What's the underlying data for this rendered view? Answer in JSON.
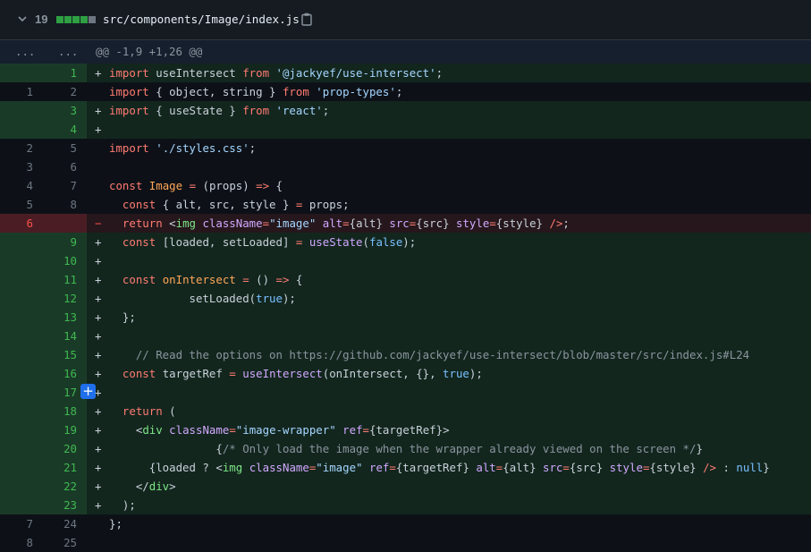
{
  "file": {
    "changes": "19",
    "path": "src/components/Image/index.js",
    "diffstat": [
      "add",
      "add",
      "add",
      "add",
      "neutral"
    ],
    "colors": {
      "add": "#2ea043",
      "neutral": "#6e7681"
    }
  },
  "hunk": {
    "old_expander": "...",
    "new_expander": "...",
    "header": "@@ -1,9 +1,26 @@"
  },
  "lines": [
    {
      "type": "add",
      "old": "",
      "new": "1",
      "sign": "+",
      "tokens": [
        [
          "kw",
          "import"
        ],
        [
          "pl",
          " useIntersect "
        ],
        [
          "kw",
          "from"
        ],
        [
          "pl",
          " "
        ],
        [
          "str",
          "'@jackyef/use-intersect'"
        ],
        [
          "pl",
          ";"
        ]
      ]
    },
    {
      "type": "ctx",
      "old": "1",
      "new": "2",
      "sign": "",
      "tokens": [
        [
          "kw",
          "import"
        ],
        [
          "pl",
          " { object, string } "
        ],
        [
          "kw",
          "from"
        ],
        [
          "pl",
          " "
        ],
        [
          "str",
          "'prop-types'"
        ],
        [
          "pl",
          ";"
        ]
      ]
    },
    {
      "type": "add",
      "old": "",
      "new": "3",
      "sign": "+",
      "tokens": [
        [
          "kw",
          "import"
        ],
        [
          "pl",
          " { useState } "
        ],
        [
          "kw",
          "from"
        ],
        [
          "pl",
          " "
        ],
        [
          "str",
          "'react'"
        ],
        [
          "pl",
          ";"
        ]
      ]
    },
    {
      "type": "add",
      "old": "",
      "new": "4",
      "sign": "+",
      "tokens": []
    },
    {
      "type": "ctx",
      "old": "2",
      "new": "5",
      "sign": "",
      "tokens": [
        [
          "kw",
          "import"
        ],
        [
          "pl",
          " "
        ],
        [
          "str",
          "'./styles.css'"
        ],
        [
          "pl",
          ";"
        ]
      ]
    },
    {
      "type": "ctx",
      "old": "3",
      "new": "6",
      "sign": "",
      "tokens": []
    },
    {
      "type": "ctx",
      "old": "4",
      "new": "7",
      "sign": "",
      "tokens": [
        [
          "kw",
          "const"
        ],
        [
          "pl",
          " "
        ],
        [
          "nm",
          "Image"
        ],
        [
          "pl",
          " "
        ],
        [
          "kw",
          "="
        ],
        [
          "pl",
          " (props) "
        ],
        [
          "kw",
          "=>"
        ],
        [
          "pl",
          " {"
        ]
      ]
    },
    {
      "type": "ctx",
      "old": "5",
      "new": "8",
      "sign": "",
      "tokens": [
        [
          "pl",
          "  "
        ],
        [
          "kw",
          "const"
        ],
        [
          "pl",
          " { alt, src, style } "
        ],
        [
          "kw",
          "="
        ],
        [
          "pl",
          " props;"
        ]
      ]
    },
    {
      "type": "del",
      "old": "6",
      "new": "",
      "sign": "−",
      "tokens": [
        [
          "pl",
          "  "
        ],
        [
          "kw",
          "return"
        ],
        [
          "pl",
          " <"
        ],
        [
          "tag",
          "img"
        ],
        [
          "pl",
          " "
        ],
        [
          "attr",
          "className"
        ],
        [
          "kw",
          "="
        ],
        [
          "str",
          "\"image\""
        ],
        [
          "pl",
          " "
        ],
        [
          "attr",
          "alt"
        ],
        [
          "kw",
          "="
        ],
        [
          "pl",
          "{alt} "
        ],
        [
          "attr",
          "src"
        ],
        [
          "kw",
          "="
        ],
        [
          "pl",
          "{src} "
        ],
        [
          "attr",
          "style"
        ],
        [
          "kw",
          "="
        ],
        [
          "pl",
          "{style} "
        ],
        [
          "kw",
          "/>"
        ],
        [
          "pl",
          ";"
        ]
      ]
    },
    {
      "type": "add",
      "old": "",
      "new": "9",
      "sign": "+",
      "tokens": [
        [
          "pl",
          "  "
        ],
        [
          "kw",
          "const"
        ],
        [
          "pl",
          " [loaded, setLoaded] "
        ],
        [
          "kw",
          "="
        ],
        [
          "pl",
          " "
        ],
        [
          "fn",
          "useState"
        ],
        [
          "pl",
          "("
        ],
        [
          "bool",
          "false"
        ],
        [
          "pl",
          ");"
        ]
      ]
    },
    {
      "type": "add",
      "old": "",
      "new": "10",
      "sign": "+",
      "tokens": []
    },
    {
      "type": "add",
      "old": "",
      "new": "11",
      "sign": "+",
      "tokens": [
        [
          "pl",
          "  "
        ],
        [
          "kw",
          "const"
        ],
        [
          "pl",
          " "
        ],
        [
          "nm",
          "onIntersect"
        ],
        [
          "pl",
          " "
        ],
        [
          "kw",
          "="
        ],
        [
          "pl",
          " () "
        ],
        [
          "kw",
          "=>"
        ],
        [
          "pl",
          " {"
        ]
      ]
    },
    {
      "type": "add",
      "old": "",
      "new": "12",
      "sign": "+",
      "tokens": [
        [
          "pl",
          "            setLoaded("
        ],
        [
          "bool",
          "true"
        ],
        [
          "pl",
          ");"
        ]
      ]
    },
    {
      "type": "add",
      "old": "",
      "new": "13",
      "sign": "+",
      "tokens": [
        [
          "pl",
          "  };"
        ]
      ]
    },
    {
      "type": "add",
      "old": "",
      "new": "14",
      "sign": "+",
      "tokens": []
    },
    {
      "type": "add",
      "old": "",
      "new": "15",
      "sign": "+",
      "tokens": [
        [
          "pl",
          "    "
        ],
        [
          "cm",
          "// Read the options on https://github.com/jackyef/use-intersect/blob/master/src/index.js#L24"
        ]
      ]
    },
    {
      "type": "add",
      "old": "",
      "new": "16",
      "sign": "+",
      "tokens": [
        [
          "pl",
          "  "
        ],
        [
          "kw",
          "const"
        ],
        [
          "pl",
          " targetRef "
        ],
        [
          "kw",
          "="
        ],
        [
          "pl",
          " "
        ],
        [
          "fn",
          "useIntersect"
        ],
        [
          "pl",
          "(onIntersect, {}, "
        ],
        [
          "bool",
          "true"
        ],
        [
          "pl",
          ");"
        ]
      ]
    },
    {
      "type": "add",
      "old": "",
      "new": "17",
      "sign": "+",
      "tokens": [],
      "hover": true
    },
    {
      "type": "add",
      "old": "",
      "new": "18",
      "sign": "+",
      "tokens": [
        [
          "pl",
          "  "
        ],
        [
          "kw",
          "return"
        ],
        [
          "pl",
          " ("
        ]
      ]
    },
    {
      "type": "add",
      "old": "",
      "new": "19",
      "sign": "+",
      "tokens": [
        [
          "pl",
          "    <"
        ],
        [
          "tag",
          "div"
        ],
        [
          "pl",
          " "
        ],
        [
          "attr",
          "className"
        ],
        [
          "kw",
          "="
        ],
        [
          "str",
          "\"image-wrapper\""
        ],
        [
          "pl",
          " "
        ],
        [
          "attr",
          "ref"
        ],
        [
          "kw",
          "="
        ],
        [
          "pl",
          "{targetRef}>"
        ]
      ]
    },
    {
      "type": "add",
      "old": "",
      "new": "20",
      "sign": "+",
      "tokens": [
        [
          "pl",
          "                {"
        ],
        [
          "cm",
          "/* Only load the image when the wrapper already viewed on the screen */"
        ],
        [
          "pl",
          "}"
        ]
      ]
    },
    {
      "type": "add",
      "old": "",
      "new": "21",
      "sign": "+",
      "tokens": [
        [
          "pl",
          "      {loaded ? <"
        ],
        [
          "tag",
          "img"
        ],
        [
          "pl",
          " "
        ],
        [
          "attr",
          "className"
        ],
        [
          "kw",
          "="
        ],
        [
          "str",
          "\"image\""
        ],
        [
          "pl",
          " "
        ],
        [
          "attr",
          "ref"
        ],
        [
          "kw",
          "="
        ],
        [
          "pl",
          "{targetRef} "
        ],
        [
          "attr",
          "alt"
        ],
        [
          "kw",
          "="
        ],
        [
          "pl",
          "{alt} "
        ],
        [
          "attr",
          "src"
        ],
        [
          "kw",
          "="
        ],
        [
          "pl",
          "{src} "
        ],
        [
          "attr",
          "style"
        ],
        [
          "kw",
          "="
        ],
        [
          "pl",
          "{style} "
        ],
        [
          "kw",
          "/>"
        ],
        [
          "pl",
          " : "
        ],
        [
          "bool",
          "null"
        ],
        [
          "pl",
          "}"
        ]
      ]
    },
    {
      "type": "add",
      "old": "",
      "new": "22",
      "sign": "+",
      "tokens": [
        [
          "pl",
          "    </"
        ],
        [
          "tag",
          "div"
        ],
        [
          "pl",
          ">"
        ]
      ]
    },
    {
      "type": "add",
      "old": "",
      "new": "23",
      "sign": "+",
      "tokens": [
        [
          "pl",
          "  );"
        ]
      ]
    },
    {
      "type": "ctx",
      "old": "7",
      "new": "24",
      "sign": "",
      "tokens": [
        [
          "pl",
          "};"
        ]
      ]
    },
    {
      "type": "ctx",
      "old": "8",
      "new": "25",
      "sign": "",
      "tokens": []
    }
  ]
}
